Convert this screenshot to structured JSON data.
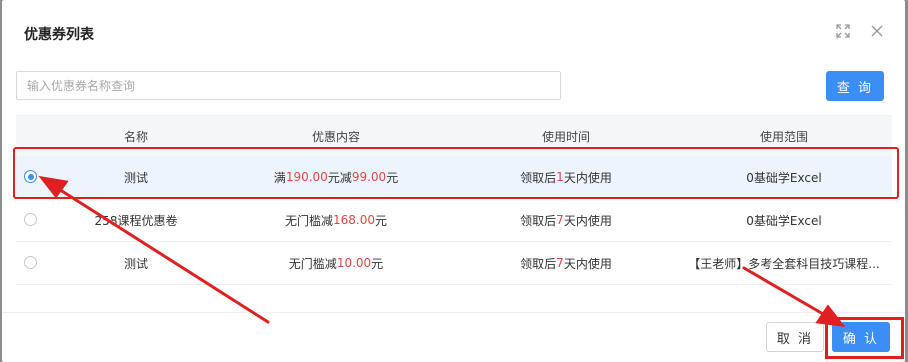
{
  "dialog": {
    "title": "优惠券列表",
    "expand_icon": "expand-icon",
    "close_icon": "close-icon"
  },
  "search": {
    "placeholder": "输入优惠券名称查询",
    "value": "",
    "button_label": "查 询"
  },
  "table": {
    "headers": [
      "名称",
      "优惠内容",
      "使用时间",
      "使用范围"
    ],
    "rows": [
      {
        "selected": true,
        "name": "测试",
        "content": {
          "prefix": "满",
          "amount1": "190.00",
          "mid": "元减",
          "amount2": "99.00",
          "suffix": "元"
        },
        "time": {
          "prefix": "领取后",
          "days": "1",
          "suffix": "天内使用"
        },
        "range": "0基础学Excel"
      },
      {
        "selected": false,
        "name": "258课程优惠卷",
        "content": {
          "prefix": "无门槛减",
          "amount": "168.00",
          "suffix": "元"
        },
        "time": {
          "prefix": "领取后",
          "days": "7",
          "suffix": "天内使用"
        },
        "range": "0基础学Excel"
      },
      {
        "selected": false,
        "name": "测试",
        "content": {
          "prefix": "无门槛减",
          "amount": "10.00",
          "suffix": "元"
        },
        "time": {
          "prefix": "领取后",
          "days": "7",
          "suffix": "天内使用"
        },
        "range": "【王老师】多考全套科目技巧课程..."
      }
    ]
  },
  "footer": {
    "cancel_label": "取 消",
    "confirm_label": "确 认"
  },
  "colors": {
    "primary": "#3a8ef6",
    "price_red": "#e54545",
    "annotation_red": "#e02020"
  }
}
